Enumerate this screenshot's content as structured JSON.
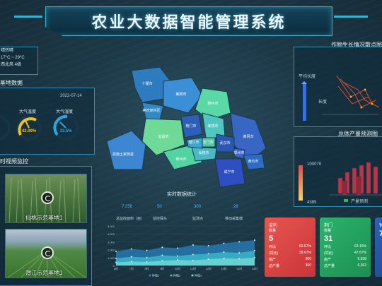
{
  "header": {
    "title": "农业大数据智能管理系统"
  },
  "weather": {
    "condition": "晴转晴",
    "temp": "17°C ~ 29°C",
    "wind": "西北风 4级"
  },
  "base_panel": {
    "title": "基地数据",
    "date": "2022-07-14",
    "gauges": [
      {
        "label": "",
        "value": "",
        "color": "#e24b4b"
      },
      {
        "label": "大气温度",
        "value": "42.09%",
        "color": "#f1c21b"
      },
      {
        "label": "大气湿度",
        "value": "33.5%",
        "color": "#2aa6e0"
      }
    ]
  },
  "video_panel": {
    "title": "时视频监控",
    "feeds": [
      {
        "caption": "仙桃示范基地1"
      },
      {
        "caption": "潜江示范基地1"
      }
    ]
  },
  "map": {
    "regions": [
      {
        "name": "十堰市",
        "color": "#2f7bc0"
      },
      {
        "name": "襄阳市",
        "color": "#3b8fd6"
      },
      {
        "name": "随州市",
        "color": "#5ad8a6"
      },
      {
        "name": "神农架林区",
        "color": "#2f8ac7"
      },
      {
        "name": "荆门市",
        "color": "#2d5fb8"
      },
      {
        "name": "孝感市",
        "color": "#4fc7c0"
      },
      {
        "name": "黄冈市",
        "color": "#3766c4"
      },
      {
        "name": "恩施土家族苗族自治州",
        "color": "#3d86d2"
      },
      {
        "name": "宜昌市",
        "color": "#6fda98"
      },
      {
        "name": "天门市",
        "color": "#56c8a6"
      },
      {
        "name": "武汉市",
        "color": "#2c58b0"
      },
      {
        "name": "荆州市",
        "color": "#52d4a2"
      },
      {
        "name": "仙桃市",
        "color": "#4bb8c6"
      },
      {
        "name": "潜江市",
        "color": "#3aa7d0"
      },
      {
        "name": "鄂州市",
        "color": "#3b66c8"
      },
      {
        "name": "黄石市",
        "color": "#2e6cc3"
      },
      {
        "name": "咸宁市",
        "color": "#2f4ec0"
      }
    ]
  },
  "realtime": {
    "title": "实时数据统计",
    "stats": [
      {
        "value": "7 258",
        "label": "总监控面积（亩）"
      },
      {
        "value": "50",
        "label": "监控探头"
      },
      {
        "value": "300",
        "label": "监测点"
      },
      {
        "value": "28",
        "label": "移动采集端"
      }
    ]
  },
  "growth_panel": {
    "title": "作物生长情况散点图",
    "axis_label": "平均长度",
    "sub_label": "长度"
  },
  "yield_panel": {
    "title": "总体产量预测图",
    "top_value": "100079",
    "bottom_value": "4385",
    "legend": "产量预测"
  },
  "cards": [
    {
      "title": "监利",
      "sub": "数量",
      "value": "5",
      "rows": [
        [
          "环比",
          "69.67%"
        ],
        [
          "(同比)",
          "39.67%"
        ],
        [
          "亩产",
          "300"
        ],
        [
          "总产量",
          "300"
        ]
      ],
      "color_a": "#e8564e",
      "color_b": "#c9343a"
    },
    {
      "title": "荆门",
      "sub": "数量",
      "value": "31",
      "rows": [
        [
          "环比",
          "63.16%"
        ],
        [
          "(同比)",
          "47.67%"
        ],
        [
          "亩产",
          "6,928"
        ],
        [
          "总产量",
          "6,363"
        ]
      ],
      "color_a": "#2bb36b",
      "color_b": "#1d8f52"
    },
    {
      "title": "钟",
      "sub": "",
      "value": "7",
      "rows": [],
      "color_a": "#2a63b8",
      "color_b": "#1e4e98"
    }
  ],
  "line_chart": {
    "y_ticks": [
      "5,000",
      "4,000",
      "3,000",
      "2,000",
      "1,000",
      "0"
    ],
    "x": [
      "6时",
      "7时",
      "8时",
      "9时",
      "10时",
      "11时",
      "12时",
      "13时",
      "14时",
      "15时"
    ],
    "series": [
      {
        "name": "种植1",
        "values": [
          1800,
          2100,
          1900,
          2300,
          2200,
          2600,
          2500,
          2800,
          3000,
          3200
        ]
      },
      {
        "name": "种植2",
        "values": [
          900,
          1100,
          1000,
          1300,
          1200,
          1400,
          1500,
          1700,
          1600,
          1900
        ]
      },
      {
        "name": "种植3",
        "values": [
          400,
          500,
          450,
          600,
          700,
          650,
          800,
          900,
          850,
          1000
        ]
      }
    ]
  }
}
